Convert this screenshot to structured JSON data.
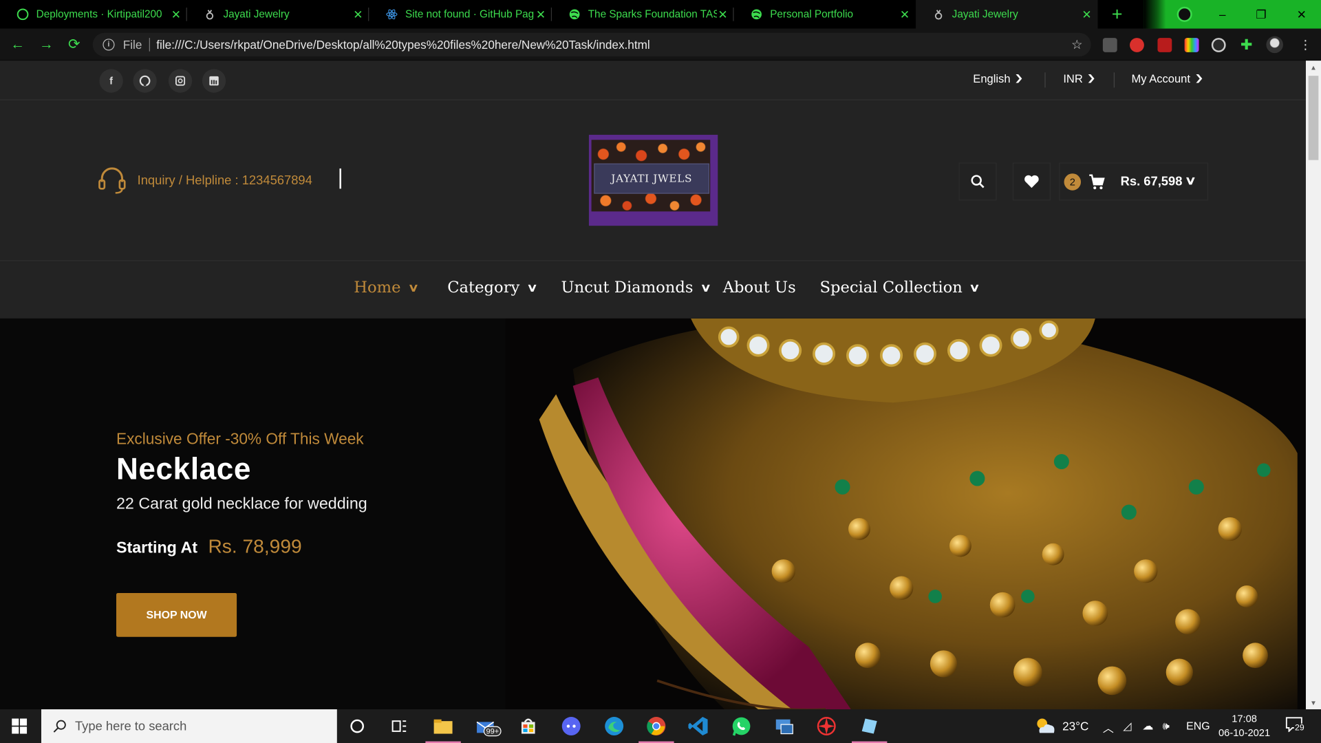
{
  "browser": {
    "tabs": [
      {
        "label": "Deployments · Kirtipatil200",
        "icon": "github-icon",
        "active": false
      },
      {
        "label": "Jayati Jewelry",
        "icon": "jewelry-favicon",
        "active": false
      },
      {
        "label": "Site not found · GitHub Pag",
        "icon": "react-icon",
        "active": false
      },
      {
        "label": "The Sparks Foundation TASK",
        "icon": "globe-icon",
        "active": false
      },
      {
        "label": "Personal Portfolio",
        "icon": "globe-icon",
        "active": false
      },
      {
        "label": "Jayati Jewelry",
        "icon": "jewelry-favicon",
        "active": true
      }
    ],
    "close_glyph": "✕",
    "new_tab_glyph": "+",
    "address": {
      "scheme_label": "File",
      "url": "file:///C:/Users/rkpat/OneDrive/Desktop/all%20types%20files%20here/New%20Task/index.html"
    },
    "window_controls": {
      "minimize": "–",
      "maximize": "❐",
      "close": "✕"
    }
  },
  "site": {
    "topbar": {
      "social": [
        {
          "name": "facebook",
          "glyph": "f"
        },
        {
          "name": "github",
          "glyph": "◉"
        },
        {
          "name": "instagram",
          "glyph": "◙"
        },
        {
          "name": "linkedin",
          "glyph": "▣"
        }
      ],
      "language": "English",
      "currency": "INR",
      "account": "My Account"
    },
    "header": {
      "helpline": "Inquiry / Helpline : 1234567894",
      "logo_text": "JAYATI JWELS",
      "cart_count": "2",
      "cart_total": "Rs. 67,598"
    },
    "nav": [
      {
        "label": "Home",
        "has_dropdown": true,
        "active": true
      },
      {
        "label": "Category",
        "has_dropdown": true,
        "active": false
      },
      {
        "label": "Uncut Diamonds",
        "has_dropdown": true,
        "active": false
      },
      {
        "label": "About Us",
        "has_dropdown": false,
        "active": false
      },
      {
        "label": "Special Collection",
        "has_dropdown": true,
        "active": false
      }
    ],
    "hero": {
      "offer": "Exclusive Offer -30% Off This Week",
      "title": "Necklace",
      "subtitle": "22 Carat gold necklace for wedding",
      "starting_label": "Starting At",
      "price": "Rs. 78,999",
      "cta": "SHOP NOW"
    },
    "colors": {
      "accent": "#c08a3a",
      "button": "#b2781f",
      "background": "#232323",
      "browser_accent": "#3ddc4e"
    }
  },
  "taskbar": {
    "search_placeholder": "Type here to search",
    "mail_badge": "99+",
    "weather": "23°C",
    "language": "ENG",
    "time": "17:08",
    "date": "06-10-2021",
    "notifications": "29"
  }
}
